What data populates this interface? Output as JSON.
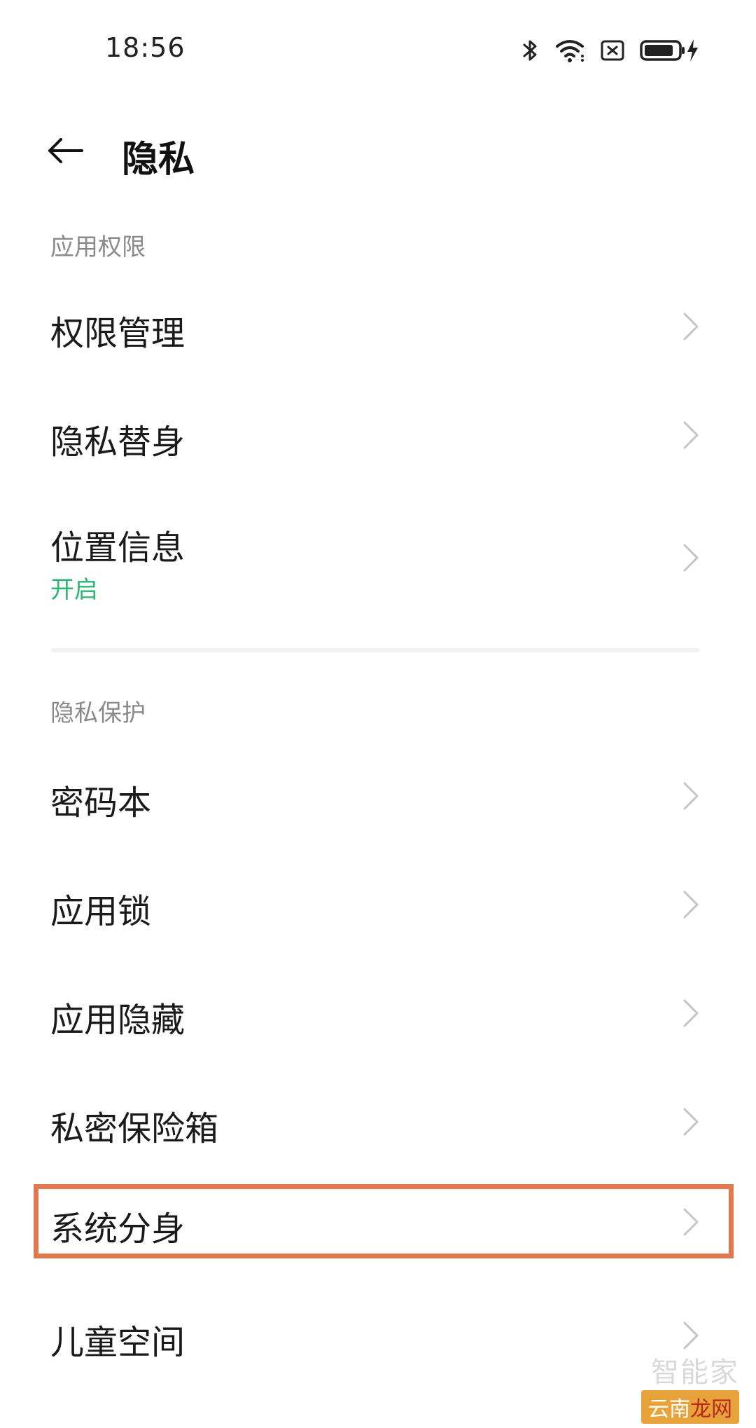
{
  "status": {
    "time": "18:56"
  },
  "header": {
    "title": "隐私"
  },
  "sections": [
    {
      "header": "应用权限",
      "items": [
        {
          "label": "权限管理"
        },
        {
          "label": "隐私替身"
        },
        {
          "label": "位置信息",
          "sub": "开启"
        }
      ]
    },
    {
      "header": "隐私保护",
      "items": [
        {
          "label": "密码本"
        },
        {
          "label": "应用锁"
        },
        {
          "label": "应用隐藏"
        },
        {
          "label": "私密保险箱"
        },
        {
          "label": "系统分身",
          "highlighted": true
        },
        {
          "label": "儿童空间"
        }
      ]
    }
  ],
  "watermark": {
    "top": "智能家",
    "bottom_a": "云南",
    "bottom_b": "龙网"
  },
  "colors": {
    "accent_green": "#2bb673",
    "highlight": "#e2784e",
    "chevron": "#c4c4c4"
  }
}
